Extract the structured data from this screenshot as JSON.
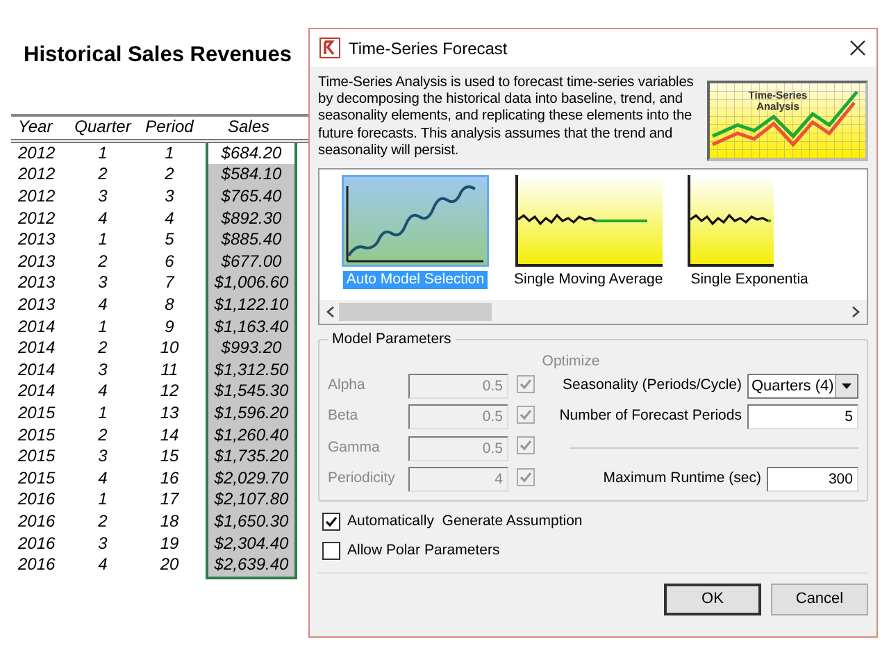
{
  "sheet": {
    "title": "Historical Sales Revenues",
    "columns": [
      "Year",
      "Quarter",
      "Period",
      "Sales"
    ],
    "rows": [
      {
        "cells": [
          "2012",
          "1",
          "1",
          "$684.20"
        ],
        "selected": false
      },
      {
        "cells": [
          "2012",
          "2",
          "2",
          "$584.10"
        ],
        "selected": true
      },
      {
        "cells": [
          "2012",
          "3",
          "3",
          "$765.40"
        ],
        "selected": true
      },
      {
        "cells": [
          "2012",
          "4",
          "4",
          "$892.30"
        ],
        "selected": true
      },
      {
        "cells": [
          "2013",
          "1",
          "5",
          "$885.40"
        ],
        "selected": true
      },
      {
        "cells": [
          "2013",
          "2",
          "6",
          "$677.00"
        ],
        "selected": true
      },
      {
        "cells": [
          "2013",
          "3",
          "7",
          "$1,006.60"
        ],
        "selected": true
      },
      {
        "cells": [
          "2013",
          "4",
          "8",
          "$1,122.10"
        ],
        "selected": true
      },
      {
        "cells": [
          "2014",
          "1",
          "9",
          "$1,163.40"
        ],
        "selected": true
      },
      {
        "cells": [
          "2014",
          "2",
          "10",
          "$993.20"
        ],
        "selected": true
      },
      {
        "cells": [
          "2014",
          "3",
          "11",
          "$1,312.50"
        ],
        "selected": true
      },
      {
        "cells": [
          "2014",
          "4",
          "12",
          "$1,545.30"
        ],
        "selected": true
      },
      {
        "cells": [
          "2015",
          "1",
          "13",
          "$1,596.20"
        ],
        "selected": true
      },
      {
        "cells": [
          "2015",
          "2",
          "14",
          "$1,260.40"
        ],
        "selected": true
      },
      {
        "cells": [
          "2015",
          "3",
          "15",
          "$1,735.20"
        ],
        "selected": true
      },
      {
        "cells": [
          "2015",
          "4",
          "16",
          "$2,029.70"
        ],
        "selected": true
      },
      {
        "cells": [
          "2016",
          "1",
          "17",
          "$2,107.80"
        ],
        "selected": true
      },
      {
        "cells": [
          "2016",
          "2",
          "18",
          "$1,650.30"
        ],
        "selected": true
      },
      {
        "cells": [
          "2016",
          "3",
          "19",
          "$2,304.40"
        ],
        "selected": true
      },
      {
        "cells": [
          "2016",
          "4",
          "20",
          "$2,639.40"
        ],
        "selected": true
      }
    ]
  },
  "dialog": {
    "title": "Time-Series Forecast",
    "description": "Time-Series Analysis is used to forecast time-series variables by decomposing the historical data into baseline, trend, and seasonality elements, and replicating these elements into the future forecasts. This analysis assumes that the trend and seasonality will persist.",
    "illustration_caption": "Time-Series Analysis",
    "models": [
      {
        "label": "Auto Model Selection",
        "kind": "auto",
        "selected": true
      },
      {
        "label": "Single Moving Average",
        "kind": "flat",
        "selected": false
      },
      {
        "label": "Single Exponentia",
        "kind": "flat",
        "selected": false
      }
    ],
    "parameters": {
      "title": "Model Parameters",
      "optimize_label": "Optimize",
      "params": [
        {
          "label": "Alpha",
          "value": "0.5",
          "optimize": true,
          "disabled": true
        },
        {
          "label": "Beta",
          "value": "0.5",
          "optimize": true,
          "disabled": true
        },
        {
          "label": "Gamma",
          "value": "0.5",
          "optimize": true,
          "disabled": true
        },
        {
          "label": "Periodicity",
          "value": "4",
          "optimize": true,
          "disabled": true
        }
      ],
      "seasonality": {
        "label": "Seasonality (Periods/Cycle)",
        "value": "Quarters (4)"
      },
      "forecast_periods": {
        "label": "Number of Forecast Periods",
        "value": "5"
      },
      "max_runtime": {
        "label": "Maximum Runtime (sec)",
        "value": "300"
      }
    },
    "options": [
      {
        "label": "Automatically  Generate Assumption",
        "checked": true
      },
      {
        "label": "Allow Polar Parameters",
        "checked": false
      }
    ],
    "buttons": [
      {
        "label": "OK",
        "default": true
      },
      {
        "label": "Cancel",
        "default": false
      }
    ]
  }
}
